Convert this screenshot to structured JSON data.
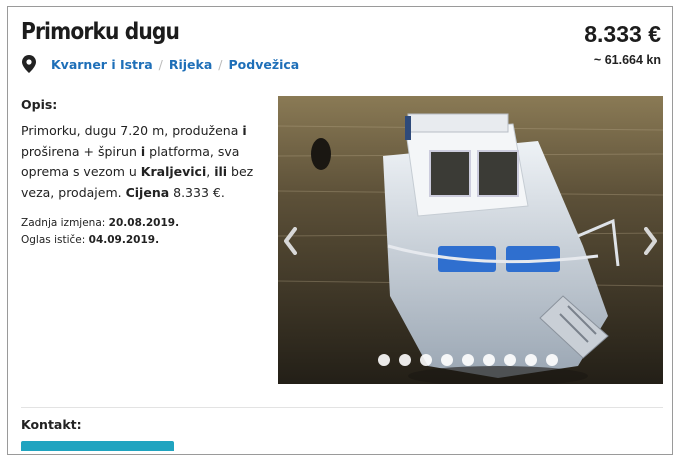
{
  "listing": {
    "title": "Primorku dugu",
    "price_eur": "8.333 €",
    "price_kn": "~ 61.664 kn"
  },
  "location": {
    "icon": "map-marker-icon",
    "crumbs": [
      "Kvarner i Istra",
      "Rijeka",
      "Podvežica"
    ],
    "separator": "/"
  },
  "description": {
    "label": "Opis:",
    "segments": [
      {
        "text": "Primorku, dugu 7.20 m, produžena ",
        "bold": false
      },
      {
        "text": "i",
        "bold": true
      },
      {
        "text": " proširena + špirun ",
        "bold": false
      },
      {
        "text": "i",
        "bold": true
      },
      {
        "text": " platforma, sva oprema s vezom u ",
        "bold": false
      },
      {
        "text": "Kraljevici",
        "bold": true
      },
      {
        "text": ", ",
        "bold": false
      },
      {
        "text": "ili",
        "bold": true
      },
      {
        "text": " bez veza, prodajem. ",
        "bold": false
      },
      {
        "text": "Cijena",
        "bold": true
      },
      {
        "text": " 8.333 €.",
        "bold": false
      }
    ]
  },
  "meta": {
    "modified_label": "Zadnja izmjena:",
    "modified_value": "20.08.2019.",
    "expires_label": "Oglas ističe:",
    "expires_value": "04.09.2019."
  },
  "gallery": {
    "image_count": 9,
    "active_index": 0,
    "prev_icon": "chevron-left-icon",
    "next_icon": "chevron-right-icon"
  },
  "contact": {
    "label": "Kontakt:"
  },
  "colors": {
    "link": "#1e6fb8",
    "accent": "#20a4c0",
    "text": "#222222"
  }
}
